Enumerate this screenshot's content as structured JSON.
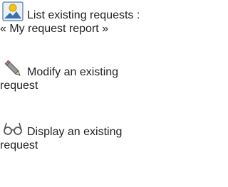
{
  "actions": [
    {
      "icon": "report-landscape-icon",
      "line1": "List existing requests :",
      "line2": "« My request report »"
    },
    {
      "icon": "pencil-icon",
      "line1": "Modify an existing",
      "line2": "request"
    },
    {
      "icon": "glasses-icon",
      "line1": "Display an existing",
      "line2": "request"
    }
  ],
  "colors": {
    "text": "#222222",
    "icon_frame": "#6f8fb8",
    "icon_sun": "#f2c21b",
    "icon_mountain": "#3b6fb0",
    "pencil_body": "#8a8a8a",
    "glasses": "#555555"
  }
}
